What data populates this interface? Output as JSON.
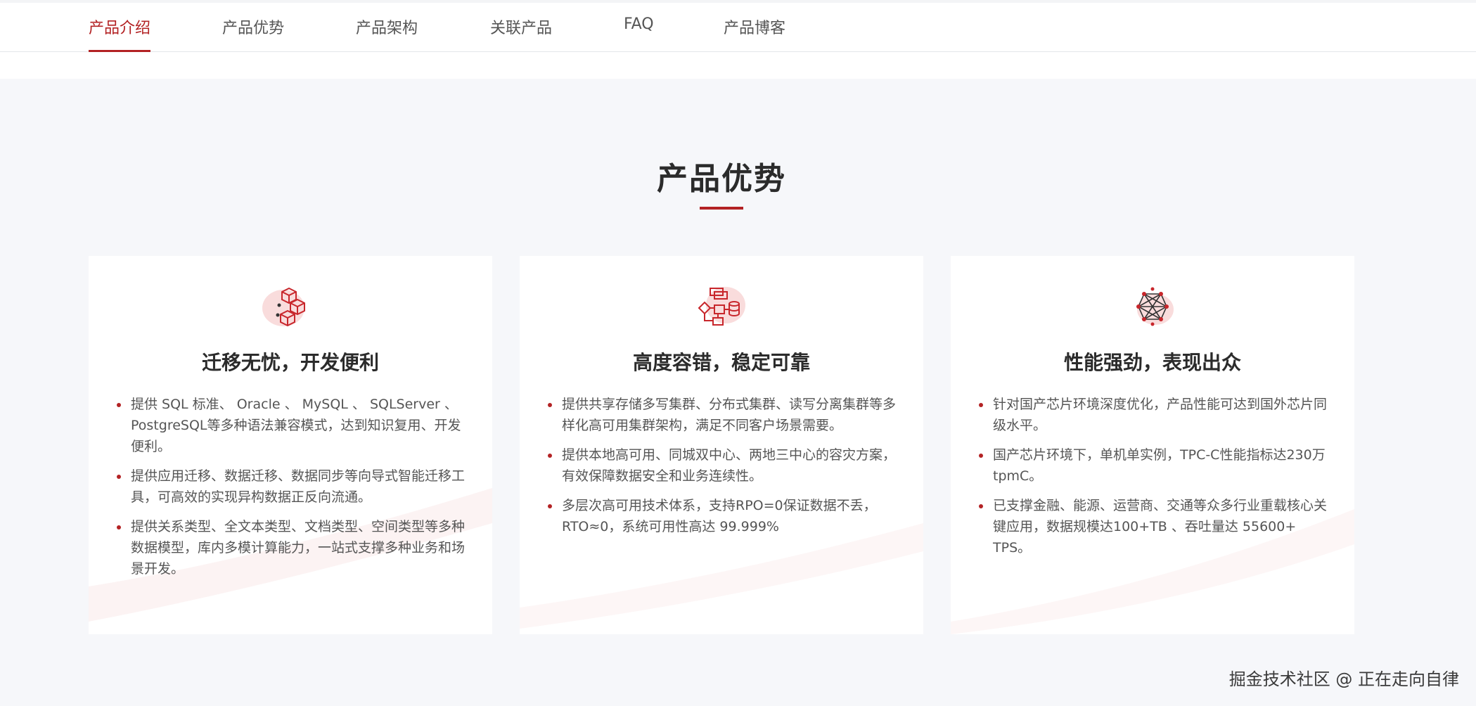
{
  "nav": {
    "items": [
      {
        "label": "产品介绍",
        "active": true
      },
      {
        "label": "产品优势",
        "active": false
      },
      {
        "label": "产品架构",
        "active": false
      },
      {
        "label": "关联产品",
        "active": false
      },
      {
        "label": "FAQ",
        "active": false
      },
      {
        "label": "产品博客",
        "active": false
      }
    ]
  },
  "section": {
    "title": "产品优势"
  },
  "cards": [
    {
      "icon": "cubes-icon",
      "title": "迁移无忧，开发便利",
      "bullets": [
        "提供 SQL 标准、 Oracle 、 MySQL 、 SQLServer 、PostgreSQL等多种语法兼容模式，达到知识复用、开发便利。",
        "提供应用迁移、数据迁移、数据同步等向导式智能迁移工具，可高效的实现异构数据正反向流通。",
        "提供关系类型、全文本类型、文档类型、空间类型等多种数据模型，库内多模计算能力，一站式支撑多种业务和场景开发。"
      ]
    },
    {
      "icon": "cluster-database-icon",
      "title": "高度容错，稳定可靠",
      "bullets": [
        "提供共享存储多写集群、分布式集群、读写分离集群等多样化高可用集群架构，满足不同客户场景需要。",
        "提供本地高可用、同城双中心、两地三中心的容灾方案，有效保障数据安全和业务连续性。",
        "多层次高可用技术体系，支持RPO=0保证数据不丢，RTO≈0，系统可用性高达 99.999%"
      ]
    },
    {
      "icon": "network-performance-icon",
      "title": "性能强劲，表现出众",
      "bullets": [
        "针对国产芯片环境深度优化，产品性能可达到国外芯片同级水平。",
        "国产芯片环境下，单机单实例，TPC-C性能指标达230万tpmC。",
        "已支撑金融、能源、运营商、交通等众多行业重载核心关键应用，数据规模达100+TB 、吞吐量达 55600+ TPS。"
      ]
    }
  ],
  "watermark": {
    "text": "掘金技术社区 @ 正在走向自律"
  },
  "colors": {
    "accent": "#b32224",
    "background": "#f6f7fa",
    "card": "#ffffff"
  }
}
